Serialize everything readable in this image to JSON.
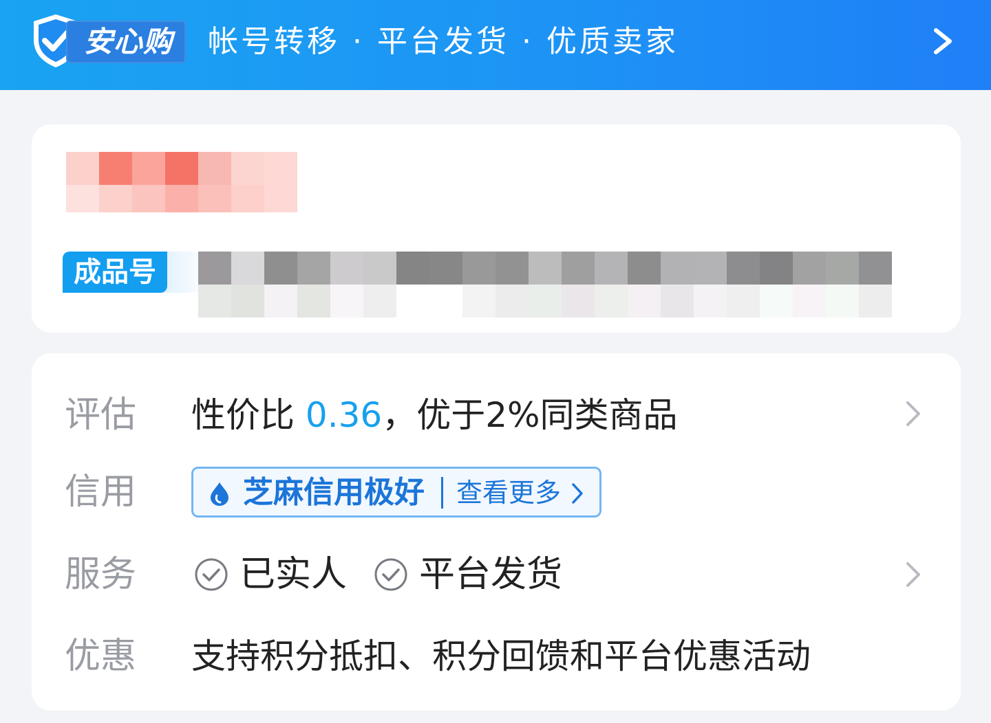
{
  "banner": {
    "brand": "安心购",
    "slogan": "帐号转移 · 平台发货 · 优质卖家",
    "icon": "shield-check-icon",
    "chevron_icon": "chevron-right-icon",
    "colors": {
      "start": "#1aa3f2",
      "end": "#1f7ff7"
    }
  },
  "listing": {
    "badge": "成品号"
  },
  "details": {
    "evaluation": {
      "label": "评估",
      "prefix": "性价比 ",
      "score": "0.36",
      "suffix": "，优于2%同类商品"
    },
    "credit": {
      "label": "信用",
      "rating": "芝麻信用极好",
      "more": "查看更多",
      "icon": "sesame-drop-icon"
    },
    "service": {
      "label": "服务",
      "items": [
        "已实人",
        "平台发货"
      ],
      "item_icon": "check-circle-icon"
    },
    "promotion": {
      "label": "优惠",
      "text": "支持积分抵扣、积分回馈和平台优惠活动"
    }
  },
  "colors": {
    "accent": "#18a0ee",
    "credit_blue": "#1c75d9",
    "label_gray": "#9a9ca3",
    "page_bg": "#f3f4f8"
  }
}
